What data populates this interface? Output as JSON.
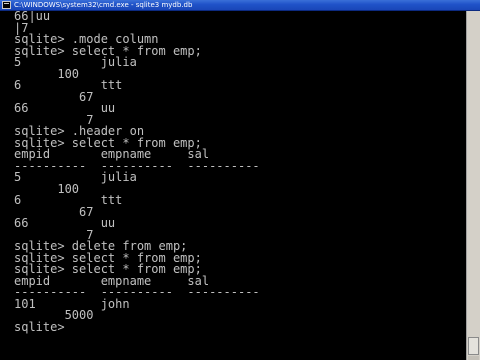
{
  "window": {
    "title": "C:\\WINDOWS\\system32\\cmd.exe - sqlite3 mydb.db"
  },
  "console": {
    "lines": [
      "66|uu",
      "|7",
      "sqlite> .mode column",
      "sqlite> select * from emp;",
      "5           julia",
      "      100",
      "6           ttt",
      "         67",
      "66          uu",
      "          7",
      "sqlite> .header on",
      "sqlite> select * from emp;",
      "empid       empname     sal",
      "----------  ----------  ----------",
      "5           julia",
      "      100",
      "6           ttt",
      "         67",
      "66          uu",
      "          7",
      "sqlite> delete from emp;",
      "sqlite> select * from emp;",
      "sqlite> select * from emp;",
      "empid       empname     sal",
      "----------  ----------  ----------",
      "101         john",
      "       5000",
      "sqlite>"
    ]
  },
  "colors": {
    "background": "#000000",
    "text": "#c0c0c0",
    "titlebar": "#1f52c8"
  },
  "icons": {
    "window_icon": "console-icon"
  }
}
